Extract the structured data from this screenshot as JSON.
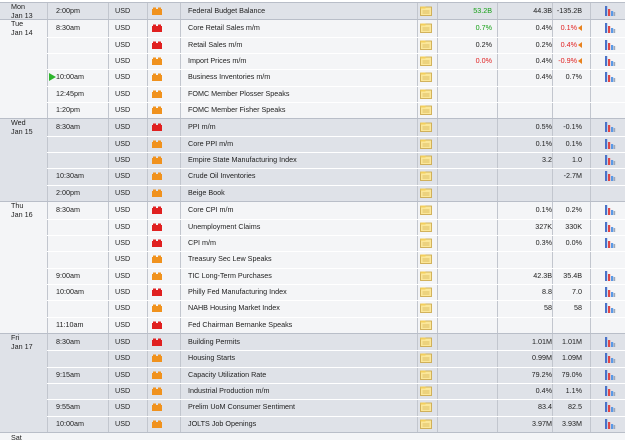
{
  "colors": {
    "impact_high": "#e02020",
    "impact_medium": "#f0921e",
    "impact_low": "#f8c640",
    "actual_better": "#16a016",
    "actual_worse": "#e02222",
    "group_shade": "#dfe2e8",
    "group_plain": "#f4f5f7"
  },
  "icons": {
    "impact": "bell-icon",
    "note": "note-icon",
    "chart": "bar-chart-icon",
    "revised": "revised-arrow-icon",
    "now_marker": "play-icon"
  },
  "calendar": {
    "groups": [
      {
        "day": "Mon",
        "date": "Jan 13",
        "shade": "shade",
        "rows": [
          {
            "time": "2:00pm",
            "currency": "USD",
            "impact": "medium",
            "event": "Federal Budget Balance",
            "actual": "53.2B",
            "actual_color": "green",
            "forecast": "44.3B",
            "previous": "-135.2B",
            "previous_color": "",
            "revised": false,
            "chart": true
          }
        ]
      },
      {
        "day": "Tue",
        "date": "Jan 14",
        "shade": "plain",
        "rows": [
          {
            "time": "8:30am",
            "currency": "USD",
            "impact": "high",
            "event": "Core Retail Sales m/m",
            "actual": "0.7%",
            "actual_color": "green",
            "forecast": "0.4%",
            "previous": "0.1%",
            "previous_color": "red",
            "revised": true,
            "chart": true
          },
          {
            "time": "",
            "currency": "USD",
            "impact": "high",
            "event": "Retail Sales m/m",
            "actual": "0.2%",
            "actual_color": "",
            "forecast": "0.2%",
            "previous": "0.4%",
            "previous_color": "red",
            "revised": true,
            "chart": true
          },
          {
            "time": "",
            "currency": "USD",
            "impact": "medium",
            "event": "Import Prices m/m",
            "actual": "0.0%",
            "actual_color": "red",
            "forecast": "0.4%",
            "previous": "-0.9%",
            "previous_color": "red",
            "revised": true,
            "chart": true
          },
          {
            "time": "10:00am",
            "currency": "USD",
            "impact": "medium",
            "event": "Business Inventories m/m",
            "actual": "",
            "actual_color": "",
            "forecast": "0.4%",
            "previous": "0.7%",
            "previous_color": "",
            "revised": false,
            "chart": true,
            "now": true
          },
          {
            "time": "12:45pm",
            "currency": "USD",
            "impact": "medium",
            "event": "FOMC Member Plosser Speaks",
            "actual": "",
            "actual_color": "",
            "forecast": "",
            "previous": "",
            "previous_color": "",
            "revised": false,
            "chart": false
          },
          {
            "time": "1:20pm",
            "currency": "USD",
            "impact": "medium",
            "event": "FOMC Member Fisher Speaks",
            "actual": "",
            "actual_color": "",
            "forecast": "",
            "previous": "",
            "previous_color": "",
            "revised": false,
            "chart": false
          }
        ]
      },
      {
        "day": "Wed",
        "date": "Jan 15",
        "shade": "shade",
        "rows": [
          {
            "time": "8:30am",
            "currency": "USD",
            "impact": "high",
            "event": "PPI m/m",
            "actual": "",
            "actual_color": "",
            "forecast": "0.5%",
            "previous": "-0.1%",
            "previous_color": "",
            "revised": false,
            "chart": true
          },
          {
            "time": "",
            "currency": "USD",
            "impact": "medium",
            "event": "Core PPI m/m",
            "actual": "",
            "actual_color": "",
            "forecast": "0.1%",
            "previous": "0.1%",
            "previous_color": "",
            "revised": false,
            "chart": true
          },
          {
            "time": "",
            "currency": "USD",
            "impact": "medium",
            "event": "Empire State Manufacturing Index",
            "actual": "",
            "actual_color": "",
            "forecast": "3.2",
            "previous": "1.0",
            "previous_color": "",
            "revised": false,
            "chart": true
          },
          {
            "time": "10:30am",
            "currency": "USD",
            "impact": "medium",
            "event": "Crude Oil Inventories",
            "actual": "",
            "actual_color": "",
            "forecast": "",
            "previous": "-2.7M",
            "previous_color": "",
            "revised": false,
            "chart": true
          },
          {
            "time": "2:00pm",
            "currency": "USD",
            "impact": "medium",
            "event": "Beige Book",
            "actual": "",
            "actual_color": "",
            "forecast": "",
            "previous": "",
            "previous_color": "",
            "revised": false,
            "chart": false
          }
        ]
      },
      {
        "day": "Thu",
        "date": "Jan 16",
        "shade": "plain",
        "rows": [
          {
            "time": "8:30am",
            "currency": "USD",
            "impact": "high",
            "event": "Core CPI m/m",
            "actual": "",
            "actual_color": "",
            "forecast": "0.1%",
            "previous": "0.2%",
            "previous_color": "",
            "revised": false,
            "chart": true
          },
          {
            "time": "",
            "currency": "USD",
            "impact": "high",
            "event": "Unemployment Claims",
            "actual": "",
            "actual_color": "",
            "forecast": "327K",
            "previous": "330K",
            "previous_color": "",
            "revised": false,
            "chart": true
          },
          {
            "time": "",
            "currency": "USD",
            "impact": "high",
            "event": "CPI m/m",
            "actual": "",
            "actual_color": "",
            "forecast": "0.3%",
            "previous": "0.0%",
            "previous_color": "",
            "revised": false,
            "chart": true
          },
          {
            "time": "",
            "currency": "USD",
            "impact": "medium",
            "event": "Treasury Sec Lew Speaks",
            "actual": "",
            "actual_color": "",
            "forecast": "",
            "previous": "",
            "previous_color": "",
            "revised": false,
            "chart": false
          },
          {
            "time": "9:00am",
            "currency": "USD",
            "impact": "medium",
            "event": "TIC Long-Term Purchases",
            "actual": "",
            "actual_color": "",
            "forecast": "42.3B",
            "previous": "35.4B",
            "previous_color": "",
            "revised": false,
            "chart": true
          },
          {
            "time": "10:00am",
            "currency": "USD",
            "impact": "high",
            "event": "Philly Fed Manufacturing Index",
            "actual": "",
            "actual_color": "",
            "forecast": "8.8",
            "previous": "7.0",
            "previous_color": "",
            "revised": false,
            "chart": true
          },
          {
            "time": "",
            "currency": "USD",
            "impact": "medium",
            "event": "NAHB Housing Market Index",
            "actual": "",
            "actual_color": "",
            "forecast": "58",
            "previous": "58",
            "previous_color": "",
            "revised": false,
            "chart": true
          },
          {
            "time": "11:10am",
            "currency": "USD",
            "impact": "high",
            "event": "Fed Chairman Bernanke Speaks",
            "actual": "",
            "actual_color": "",
            "forecast": "",
            "previous": "",
            "previous_color": "",
            "revised": false,
            "chart": false
          }
        ]
      },
      {
        "day": "Fri",
        "date": "Jan 17",
        "shade": "shade",
        "rows": [
          {
            "time": "8:30am",
            "currency": "USD",
            "impact": "high",
            "event": "Building Permits",
            "actual": "",
            "actual_color": "",
            "forecast": "1.01M",
            "previous": "1.01M",
            "previous_color": "",
            "revised": false,
            "chart": true
          },
          {
            "time": "",
            "currency": "USD",
            "impact": "medium",
            "event": "Housing Starts",
            "actual": "",
            "actual_color": "",
            "forecast": "0.99M",
            "previous": "1.09M",
            "previous_color": "",
            "revised": false,
            "chart": true
          },
          {
            "time": "9:15am",
            "currency": "USD",
            "impact": "medium",
            "event": "Capacity Utilization Rate",
            "actual": "",
            "actual_color": "",
            "forecast": "79.2%",
            "previous": "79.0%",
            "previous_color": "",
            "revised": false,
            "chart": true
          },
          {
            "time": "",
            "currency": "USD",
            "impact": "medium",
            "event": "Industrial Production m/m",
            "actual": "",
            "actual_color": "",
            "forecast": "0.4%",
            "previous": "1.1%",
            "previous_color": "",
            "revised": false,
            "chart": true
          },
          {
            "time": "9:55am",
            "currency": "USD",
            "impact": "medium",
            "event": "Prelim UoM Consumer Sentiment",
            "actual": "",
            "actual_color": "",
            "forecast": "83.4",
            "previous": "82.5",
            "previous_color": "",
            "revised": false,
            "chart": true
          },
          {
            "time": "10:00am",
            "currency": "USD",
            "impact": "medium",
            "event": "JOLTS Job Openings",
            "actual": "",
            "actual_color": "",
            "forecast": "3.97M",
            "previous": "3.93M",
            "previous_color": "",
            "revised": false,
            "chart": true
          }
        ]
      },
      {
        "day": "Sat",
        "date": "",
        "shade": "plain",
        "rows": []
      }
    ]
  }
}
